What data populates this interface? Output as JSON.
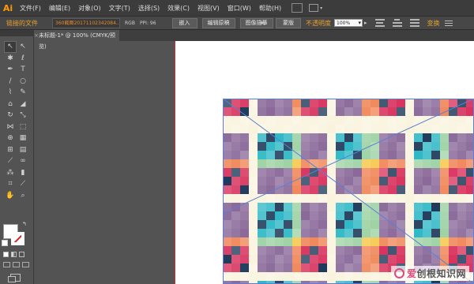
{
  "menubar": {
    "logo": "Ai",
    "items": [
      "文件(F)",
      "编辑(E)",
      "对象(O)",
      "文字(T)",
      "选择(S)",
      "效果(C)",
      "视图(V)",
      "窗口(W)",
      "帮助(H)"
    ]
  },
  "control_bar": {
    "linked_file_label": "链接的文件",
    "filename": "360截图20171102342084...",
    "color_mode": "RGB",
    "ppi_label": "PPI: 96",
    "embed_button": "嵌入",
    "edit_original_button": "编辑原稿",
    "image_trace_button": "图像描摹",
    "image_trace_dropdown": "▾",
    "mask_button": "蒙版",
    "opacity_label": "不透明度",
    "opacity_value": "100%",
    "opacity_dropdown": "▸",
    "transform_label": "变换"
  },
  "document_tab": {
    "title": "未标题-1* @ 100% (CMYK/预览)",
    "close": "×"
  },
  "toolbox": {
    "tools": [
      {
        "name": "selection-tool",
        "glyph": "↖"
      },
      {
        "name": "direct-selection-tool",
        "glyph": "↖"
      },
      {
        "name": "magic-wand-tool",
        "glyph": "✱"
      },
      {
        "name": "lasso-tool",
        "glyph": "ℓ"
      },
      {
        "name": "pen-tool",
        "glyph": "✒"
      },
      {
        "name": "type-tool",
        "glyph": "T"
      },
      {
        "name": "line-tool",
        "glyph": "/"
      },
      {
        "name": "ellipse-tool",
        "glyph": "○"
      },
      {
        "name": "paintbrush-tool",
        "glyph": "⌇"
      },
      {
        "name": "pencil-tool",
        "glyph": "✎"
      },
      {
        "name": "blob-brush-tool",
        "glyph": "⌂"
      },
      {
        "name": "eraser-tool",
        "glyph": "◢"
      },
      {
        "name": "rotate-tool",
        "glyph": "↻"
      },
      {
        "name": "scale-tool",
        "glyph": "⤡"
      },
      {
        "name": "width-tool",
        "glyph": "⋈"
      },
      {
        "name": "free-transform-tool",
        "glyph": "⬚"
      },
      {
        "name": "shape-builder-tool",
        "glyph": "⊕"
      },
      {
        "name": "perspective-grid-tool",
        "glyph": "▦"
      },
      {
        "name": "mesh-tool",
        "glyph": "⊞"
      },
      {
        "name": "gradient-tool",
        "glyph": "▤"
      },
      {
        "name": "eyedropper-tool",
        "glyph": "⟋"
      },
      {
        "name": "blend-tool",
        "glyph": "∞"
      },
      {
        "name": "symbol-sprayer-tool",
        "glyph": "⁂"
      },
      {
        "name": "column-graph-tool",
        "glyph": "▮"
      },
      {
        "name": "artboard-tool",
        "glyph": "⌗"
      },
      {
        "name": "slice-tool",
        "glyph": "⟋"
      },
      {
        "name": "hand-tool",
        "glyph": "✋"
      },
      {
        "name": "zoom-tool",
        "glyph": "⌕"
      }
    ],
    "fill_color": "#ffffff",
    "stroke_none_color": "#e02020"
  },
  "pattern": {
    "colors": [
      "#d8345f",
      "#2fb8c6",
      "#f6c542",
      "#f9f3dc",
      "#1f3a5a"
    ]
  },
  "watermark": {
    "brand_prefix": "爱",
    "brand_rest": "创根知识网"
  }
}
